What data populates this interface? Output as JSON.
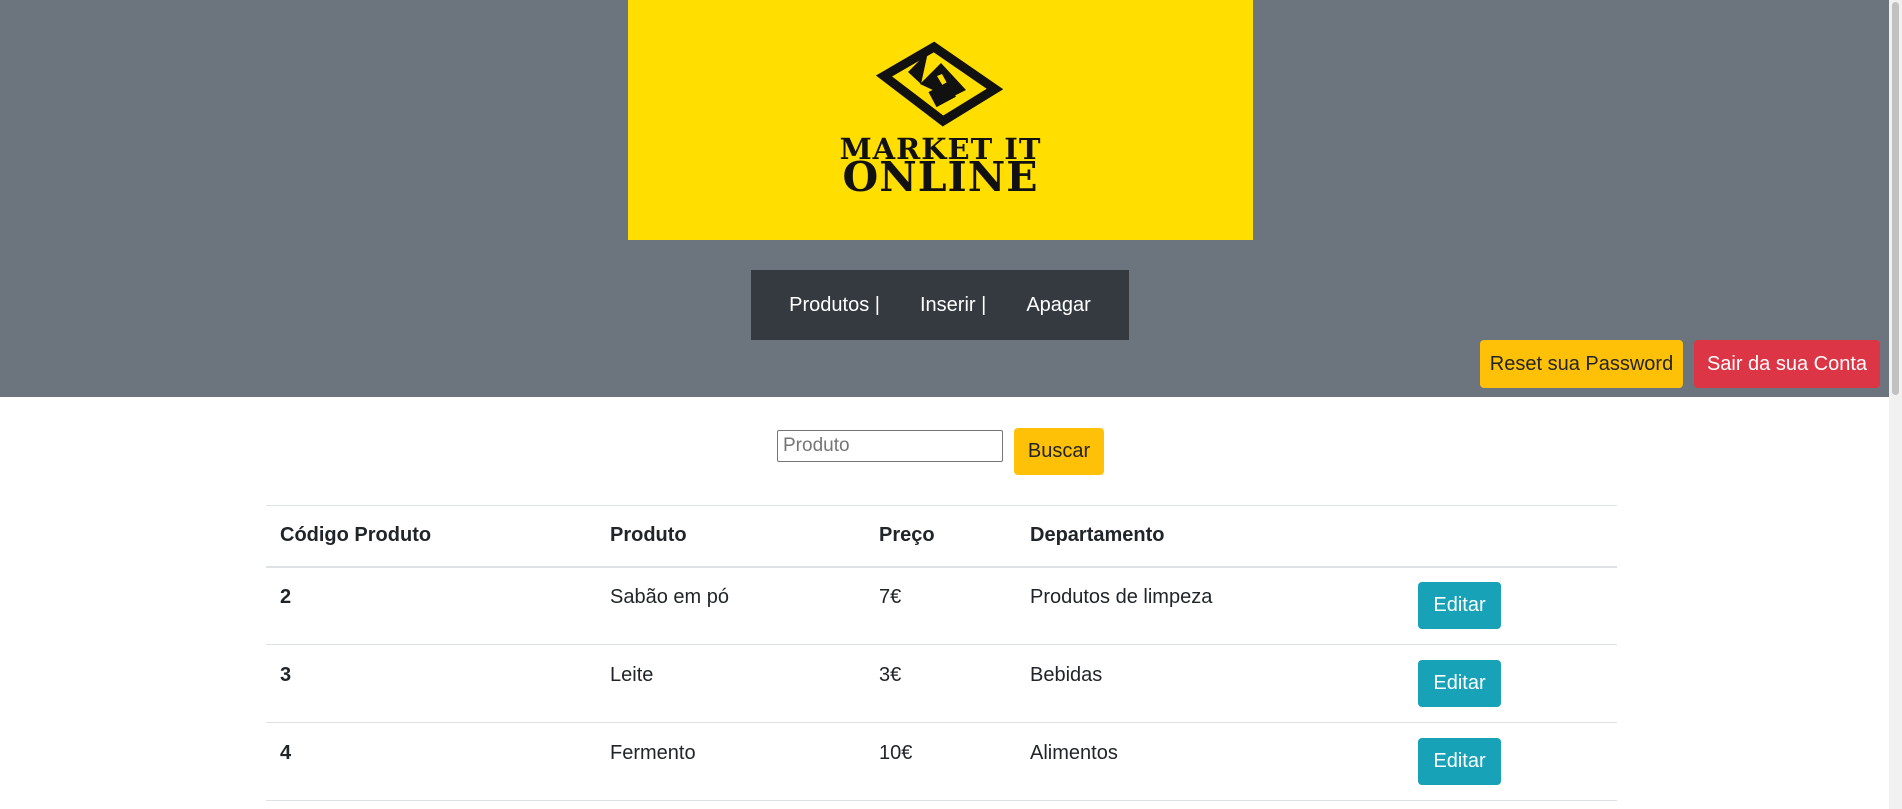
{
  "logo": {
    "line1": "MARKET IT",
    "line2": "ONLINE",
    "background_color": "#ffde00",
    "icon": "house-arrow-logo-icon"
  },
  "nav": {
    "items": [
      {
        "label": "Produtos |"
      },
      {
        "label": "Inserir |"
      },
      {
        "label": "Apagar"
      }
    ]
  },
  "account": {
    "reset_label": "Reset sua Password",
    "logout_label": "Sair da sua Conta"
  },
  "search": {
    "placeholder": "Produto",
    "button_label": "Buscar"
  },
  "table": {
    "headers": [
      "Código Produto",
      "Produto",
      "Preço",
      "Departamento"
    ],
    "rows": [
      {
        "code": "2",
        "product": "Sabão em pó",
        "price": "7€",
        "department": "Produtos de limpeza",
        "action": "Editar"
      },
      {
        "code": "3",
        "product": "Leite",
        "price": "3€",
        "department": "Bebidas",
        "action": "Editar"
      },
      {
        "code": "4",
        "product": "Fermento",
        "price": "10€",
        "department": "Alimentos",
        "action": "Editar"
      }
    ]
  },
  "colors": {
    "header_bg": "#6c757d",
    "navbar_bg": "#343a40",
    "warning": "#ffc107",
    "danger": "#dc3545",
    "info": "#17a2b8"
  }
}
